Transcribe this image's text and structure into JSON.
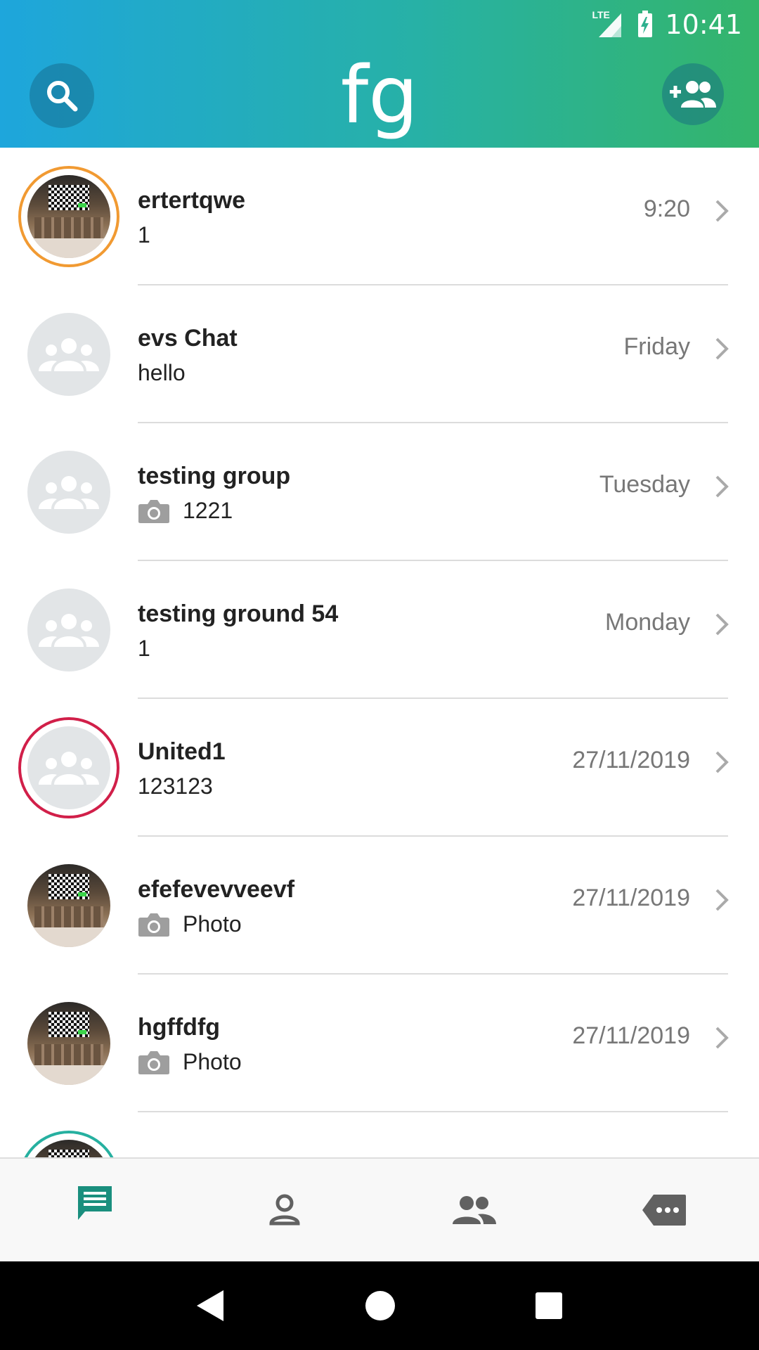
{
  "status": {
    "time": "10:41",
    "network": "LTE"
  },
  "header": {
    "title": "fg"
  },
  "colors": {
    "accent": "#1a8f7e",
    "gradient_start": "#1ea6dc",
    "gradient_end": "#34b56a"
  },
  "chats": [
    {
      "name": "ertertqwe",
      "preview": "1",
      "time": "9:20",
      "avatar": "photo",
      "ring": "orange",
      "has_camera": false
    },
    {
      "name": "evs Chat",
      "preview": "hello",
      "time": "Friday",
      "avatar": "group",
      "ring": "none",
      "has_camera": false
    },
    {
      "name": "testing group",
      "preview": "1221",
      "time": "Tuesday",
      "avatar": "group",
      "ring": "none",
      "has_camera": true
    },
    {
      "name": "testing ground 54",
      "preview": "1",
      "time": "Monday",
      "avatar": "group",
      "ring": "none",
      "has_camera": false
    },
    {
      "name": "United1",
      "preview": "123123",
      "time": "27/11/2019",
      "avatar": "group",
      "ring": "red",
      "has_camera": false
    },
    {
      "name": "efefevevveevf",
      "preview": "Photo",
      "time": "27/11/2019",
      "avatar": "photo",
      "ring": "none",
      "has_camera": true
    },
    {
      "name": "hgffdfg",
      "preview": "Photo",
      "time": "27/11/2019",
      "avatar": "photo",
      "ring": "none",
      "has_camera": true
    }
  ],
  "nav": [
    "chats-icon",
    "contact-icon",
    "groups-icon",
    "channels-icon"
  ],
  "icons": [
    "search-icon",
    "add-group-icon",
    "camera-icon",
    "chevron-right-icon",
    "back-icon",
    "home-icon",
    "recents-icon"
  ]
}
